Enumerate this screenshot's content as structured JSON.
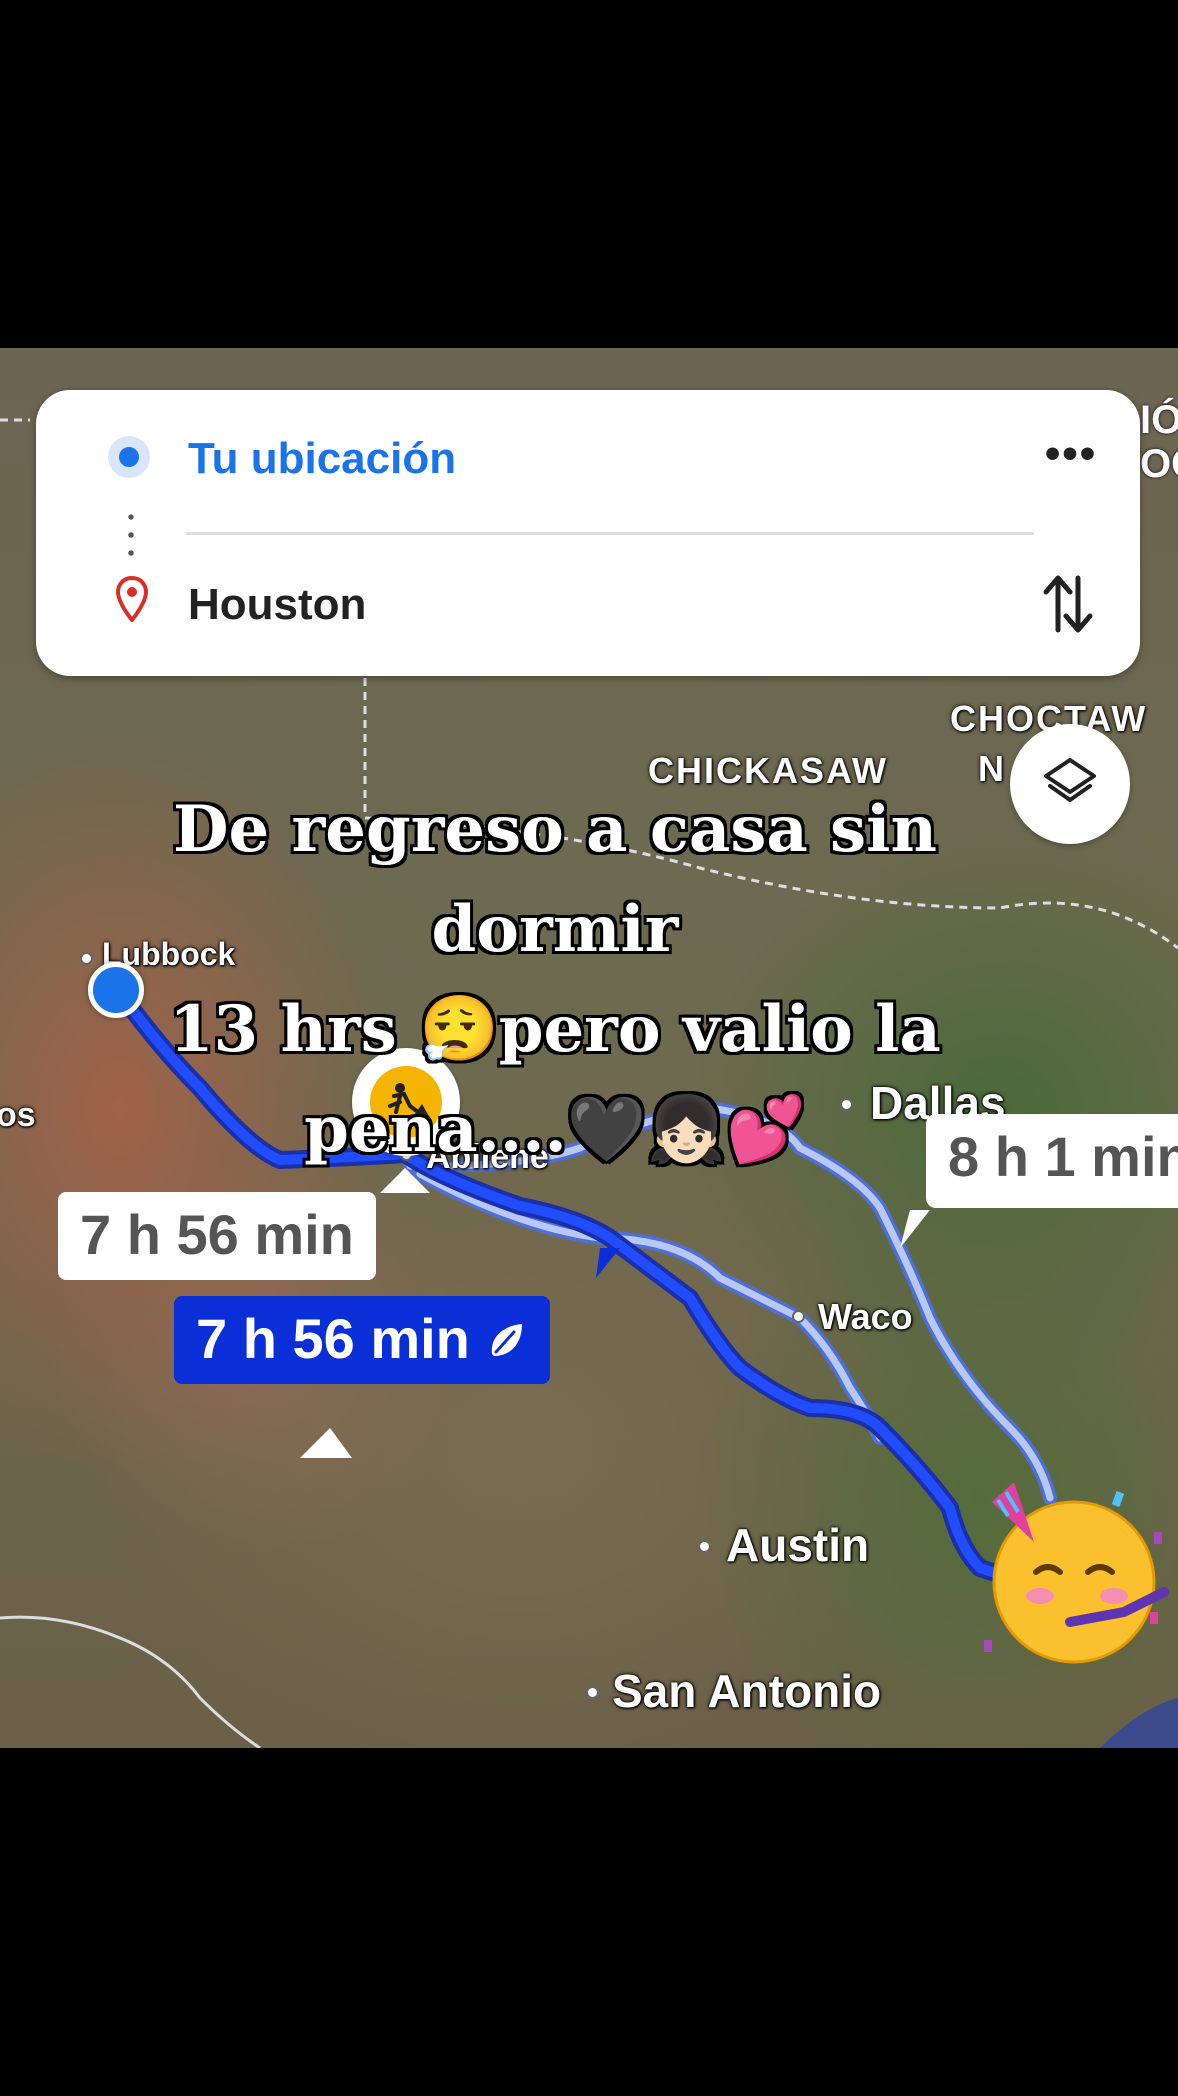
{
  "search": {
    "origin": "Tu ubicación",
    "destination": "Houston",
    "more_label": "•••"
  },
  "map": {
    "cities": {
      "lubbock": "Lubbock",
      "abilene": "Abilene",
      "dallas": "Dallas",
      "waco": "Waco",
      "austin": "Austin",
      "san_antonio": "San Antonio"
    },
    "regions": {
      "chickasaw": "CHICKASAW",
      "choctaw": "CHOCTAW",
      "choctaw_nation_fragment": "N",
      "edge_fragment": "IÓ\nOC"
    },
    "left_edge_fragment": "os"
  },
  "routes": {
    "main_duration": "7 h 56 min",
    "alt_duration_1": "7 h 56 min",
    "alt_duration_2": "8 h 1 min"
  },
  "caption": {
    "line1": "De regreso a casa sin dormir",
    "line2": "13 hrs 😮‍💨pero valio la",
    "line3": "pena....🖤👧🏻💕"
  },
  "icons": {
    "layers": "layers-icon",
    "swap": "swap-icon",
    "pin": "location-pin-icon",
    "construction": "construction-icon",
    "eco": "leaf-icon",
    "party": "partying-face-emoji"
  },
  "colors": {
    "accent_blue": "#1a73e8",
    "route_main": "#0b2fd6",
    "route_alt": "#8aa6f0",
    "pin_red": "#d93025"
  }
}
